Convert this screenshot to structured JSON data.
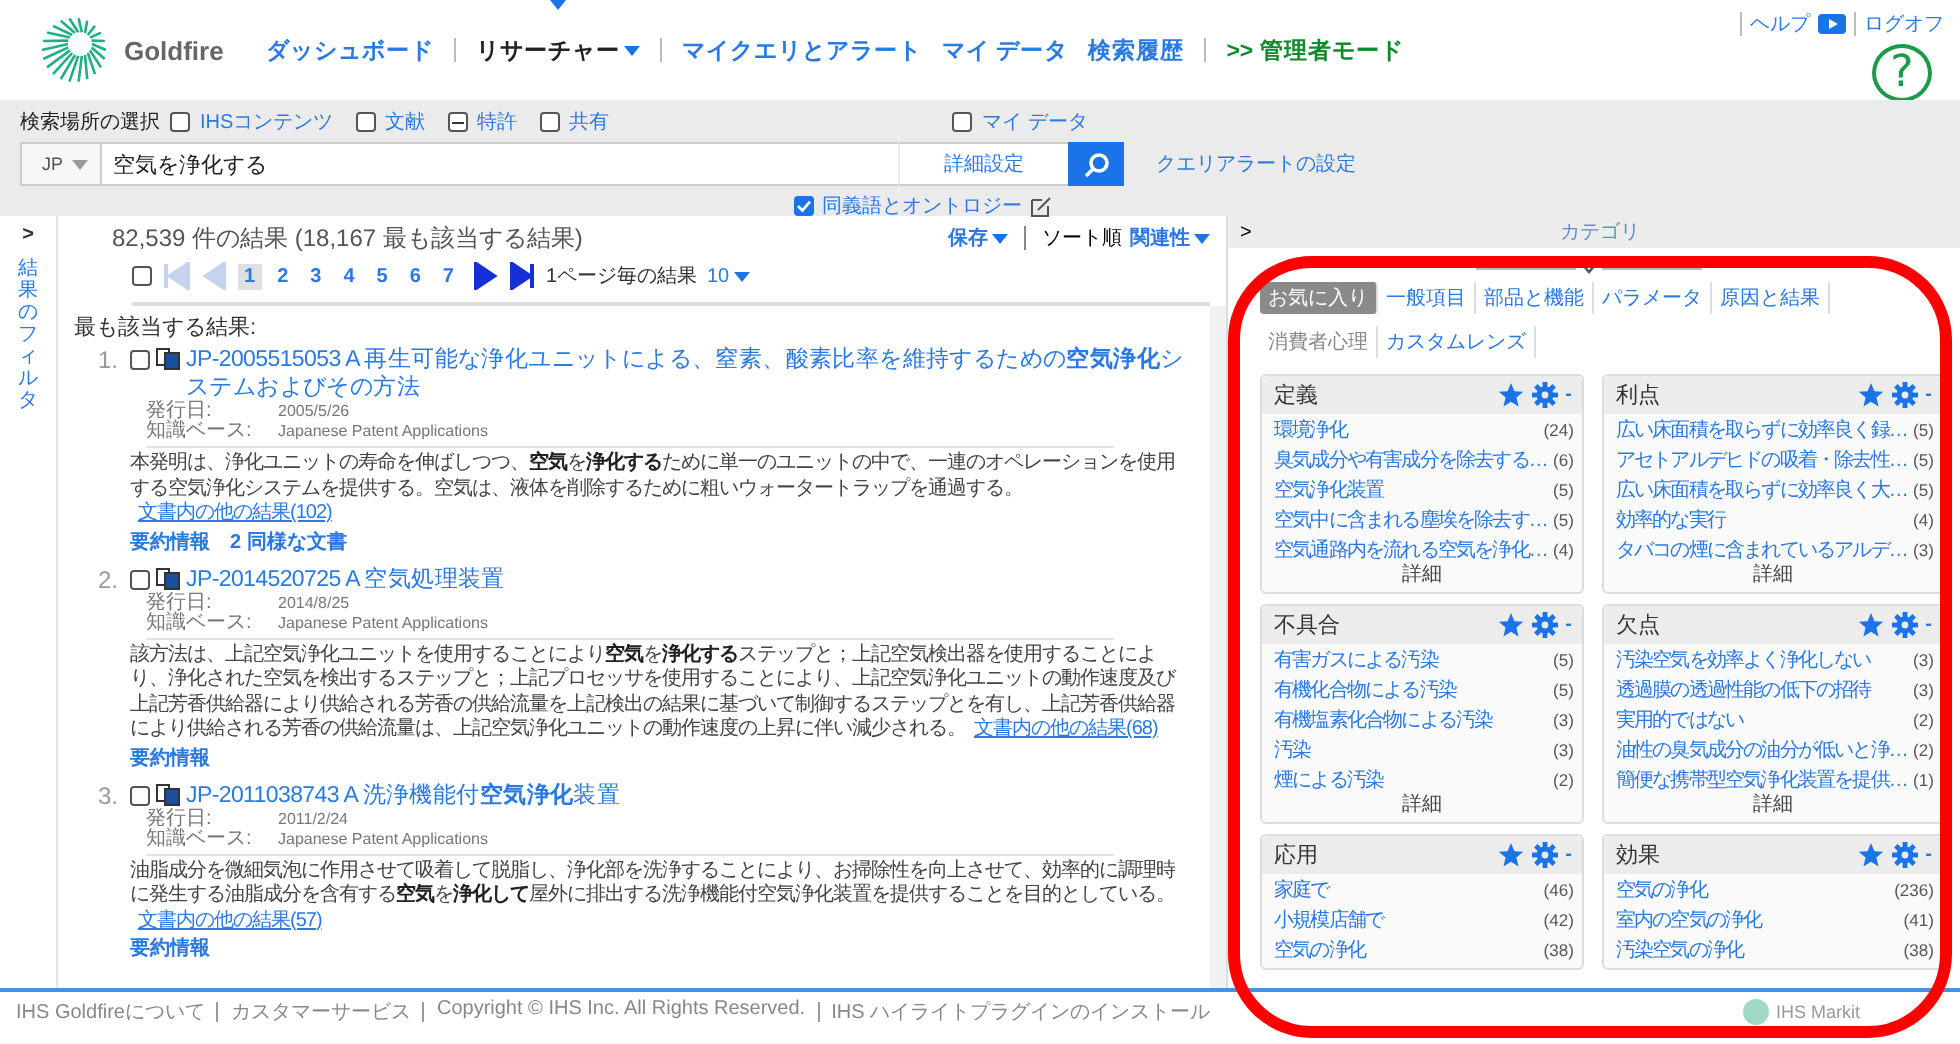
{
  "header": {
    "brand": "Goldfire",
    "nav": [
      {
        "label": "ダッシュボード",
        "kind": "link",
        "selected": false,
        "divider_before": false
      },
      {
        "label": "リサーチャー",
        "kind": "menu",
        "selected": true,
        "divider_before": true
      },
      {
        "label": "マイクエリとアラート",
        "kind": "link",
        "selected": false,
        "divider_before": true
      },
      {
        "label": "マイ データ",
        "kind": "link",
        "selected": false,
        "divider_before": false
      },
      {
        "label": "検索履歴",
        "kind": "link",
        "selected": false,
        "divider_before": false
      },
      {
        "label": ">> 管理者モード",
        "kind": "admin",
        "selected": false,
        "divider_before": true
      }
    ],
    "links": [
      "ヘルプ",
      "ログオフ"
    ],
    "help": "?"
  },
  "search": {
    "scope_label": "検索場所の選択",
    "sources": [
      {
        "label": "IHSコンテンツ",
        "checked": false,
        "indeterminate": false
      },
      {
        "label": "文献",
        "checked": false,
        "indeterminate": false
      },
      {
        "label": "特許",
        "checked": true,
        "indeterminate": true
      },
      {
        "label": "共有",
        "checked": false,
        "indeterminate": false
      }
    ],
    "my_data": {
      "label": "マイ データ",
      "checked": false
    },
    "language": "JP",
    "value": "空気を浄化する",
    "advanced": "詳細設定",
    "alert_link": "クエリアラートの設定",
    "synonyms": {
      "label": "同義語とオントロジー",
      "checked": true
    }
  },
  "filter": {
    "toggle": ">",
    "label": "結果のフィルタ"
  },
  "results": {
    "summary": "82,539 件の結果 (18,167 最も該当する結果)",
    "save": "保存",
    "sort_label": "ソート順",
    "sort_value": "関連性",
    "pager": {
      "select_all_checked": false,
      "buttons": [
        {
          "kind": "first",
          "disabled": true
        },
        {
          "kind": "prev",
          "disabled": true
        },
        {
          "kind": "next",
          "disabled": false
        },
        {
          "kind": "last",
          "disabled": false
        }
      ],
      "pages": [
        {
          "label": "1",
          "selected": true
        },
        {
          "label": "2",
          "selected": false
        },
        {
          "label": "3",
          "selected": false
        },
        {
          "label": "4",
          "selected": false
        },
        {
          "label": "5",
          "selected": false
        },
        {
          "label": "6",
          "selected": false
        },
        {
          "label": "7",
          "selected": false
        }
      ],
      "per_page_label": "1ページ毎の結果",
      "per_page": "10"
    },
    "section": "最も該当する結果:",
    "items": [
      {
        "number": "1.",
        "checked": false,
        "title": "JP-2005515053 A 再生可能な浄化ユニットによる、窒素、酸素比率を維持するための**空気浄化**システムおよびその方法",
        "date_label": "発行日:",
        "date": "2005/5/26",
        "kb_label": "知識ベース:",
        "kb": "Japanese Patent Applications",
        "abstract": "本発明は、浄化ユニットの寿命を伸ばしつつ、**空気**を**浄化する**ために単一のユニットの中で、一連のオペレーションを使用する空気浄化システムを提供する。空気は、液体を削除するために粗いウォータートラップを通過する。",
        "more": "文書内の他の結果(102)",
        "actions": [
          "要約情報",
          "2 同様な文書"
        ]
      },
      {
        "number": "2.",
        "checked": false,
        "title": "JP-2014520725 A 空気処理装置",
        "date_label": "発行日:",
        "date": "2014/8/25",
        "kb_label": "知識ベース:",
        "kb": "Japanese Patent Applications",
        "abstract": "該方法は、上記空気浄化ユニットを使用することにより**空気**を**浄化する**ステップと；上記空気検出器を使用することにより、浄化された空気を検出するステップと；上記プロセッサを使用することにより、上記空気浄化ユニットの動作速度及び上記芳香供給器により供給される芳香の供給流量を上記検出の結果に基づいて制御するステップとを有し、上記芳香供給器により供給される芳香の供給流量は、上記空気浄化ユニットの動作速度の上昇に伴い減少される。",
        "more": "文書内の他の結果(68)",
        "actions": [
          "要約情報"
        ]
      },
      {
        "number": "3.",
        "checked": false,
        "title": "JP-2011038743 A 洗浄機能付**空気浄化**装置",
        "date_label": "発行日:",
        "date": "2011/2/24",
        "kb_label": "知識ベース:",
        "kb": "Japanese Patent Applications",
        "abstract": "油脂成分を微細気泡に作用させて吸着して脱脂し、浄化部を洗浄することにより、お掃除性を向上させて、効率的に調理時に発生する油脂成分を含有する**空気**を**浄化して**屋外に排出する洗浄機能付空気浄化装置を提供することを目的としている。",
        "more": "文書内の他の結果(57)",
        "actions": [
          "要約情報"
        ]
      }
    ]
  },
  "categories": {
    "toggle": ">",
    "title": "カテゴリ",
    "tabs": [
      {
        "label": "お気に入り",
        "selected": true,
        "disabled": false
      },
      {
        "label": "一般項目",
        "selected": false,
        "disabled": false
      },
      {
        "label": "部品と機能",
        "selected": false,
        "disabled": false
      },
      {
        "label": "パラメータ",
        "selected": false,
        "disabled": false
      },
      {
        "label": "原因と結果",
        "selected": false,
        "disabled": false
      },
      {
        "label": "消費者心理",
        "selected": false,
        "disabled": true
      },
      {
        "label": "カスタムレンズ",
        "selected": false,
        "disabled": false
      }
    ],
    "cards": [
      {
        "title": "定義",
        "collapse": "-",
        "items": [
          {
            "text": "環境浄化",
            "count": "(24)"
          },
          {
            "text": "臭気成分や有害成分を除去する…",
            "count": "(6)"
          },
          {
            "text": "空気浄化装置",
            "count": "(5)"
          },
          {
            "text": "空気中に含まれる塵埃を除去す…",
            "count": "(5)"
          },
          {
            "text": "空気通路内を流れる空気を浄化…",
            "count": "(4)"
          }
        ],
        "more": "詳細"
      },
      {
        "title": "利点",
        "collapse": "-",
        "items": [
          {
            "text": "広い床面積を取らずに効率良く録…",
            "count": "(5)"
          },
          {
            "text": "アセトアルデヒドの吸着・除去性…",
            "count": "(5)"
          },
          {
            "text": "広い床面積を取らずに効率良く大…",
            "count": "(5)"
          },
          {
            "text": "効率的な実行",
            "count": "(4)"
          },
          {
            "text": "タバコの煙に含まれているアルデ…",
            "count": "(3)"
          }
        ],
        "more": "詳細"
      },
      {
        "title": "不具合",
        "collapse": "-",
        "items": [
          {
            "text": "有害ガスによる汚染",
            "count": "(5)"
          },
          {
            "text": "有機化合物による汚染",
            "count": "(5)"
          },
          {
            "text": "有機塩素化合物による汚染",
            "count": "(3)"
          },
          {
            "text": "汚染",
            "count": "(3)"
          },
          {
            "text": "煙による汚染",
            "count": "(2)"
          }
        ],
        "more": "詳細"
      },
      {
        "title": "欠点",
        "collapse": "-",
        "items": [
          {
            "text": "汚染空気を効率よく浄化しない",
            "count": "(3)"
          },
          {
            "text": "透過膜の透過性能の低下の招待",
            "count": "(3)"
          },
          {
            "text": "実用的ではない",
            "count": "(2)"
          },
          {
            "text": "油性の臭気成分の油分が低いと浄…",
            "count": "(2)"
          },
          {
            "text": "簡便な携帯型空気浄化装置を提供…",
            "count": "(1)"
          }
        ],
        "more": "詳細"
      },
      {
        "title": "応用",
        "collapse": "-",
        "items": [
          {
            "text": "家庭で",
            "count": "(46)"
          },
          {
            "text": "小規模店舗で",
            "count": "(42)"
          },
          {
            "text": "空気の浄化",
            "count": "(38)"
          }
        ]
      },
      {
        "title": "効果",
        "collapse": "-",
        "items": [
          {
            "text": "空気の浄化",
            "count": "(236)"
          },
          {
            "text": "室内の空気の浄化",
            "count": "(41)"
          },
          {
            "text": "汚染空気の浄化",
            "count": "(38)"
          }
        ]
      }
    ]
  },
  "footer": {
    "links": [
      "IHS Goldfireについて",
      "カスタマーサービス",
      "Copyright © IHS Inc. All Rights Reserved.",
      "IHS ハイライトプラグインのインストール"
    ],
    "logo": "IHS Markit"
  }
}
